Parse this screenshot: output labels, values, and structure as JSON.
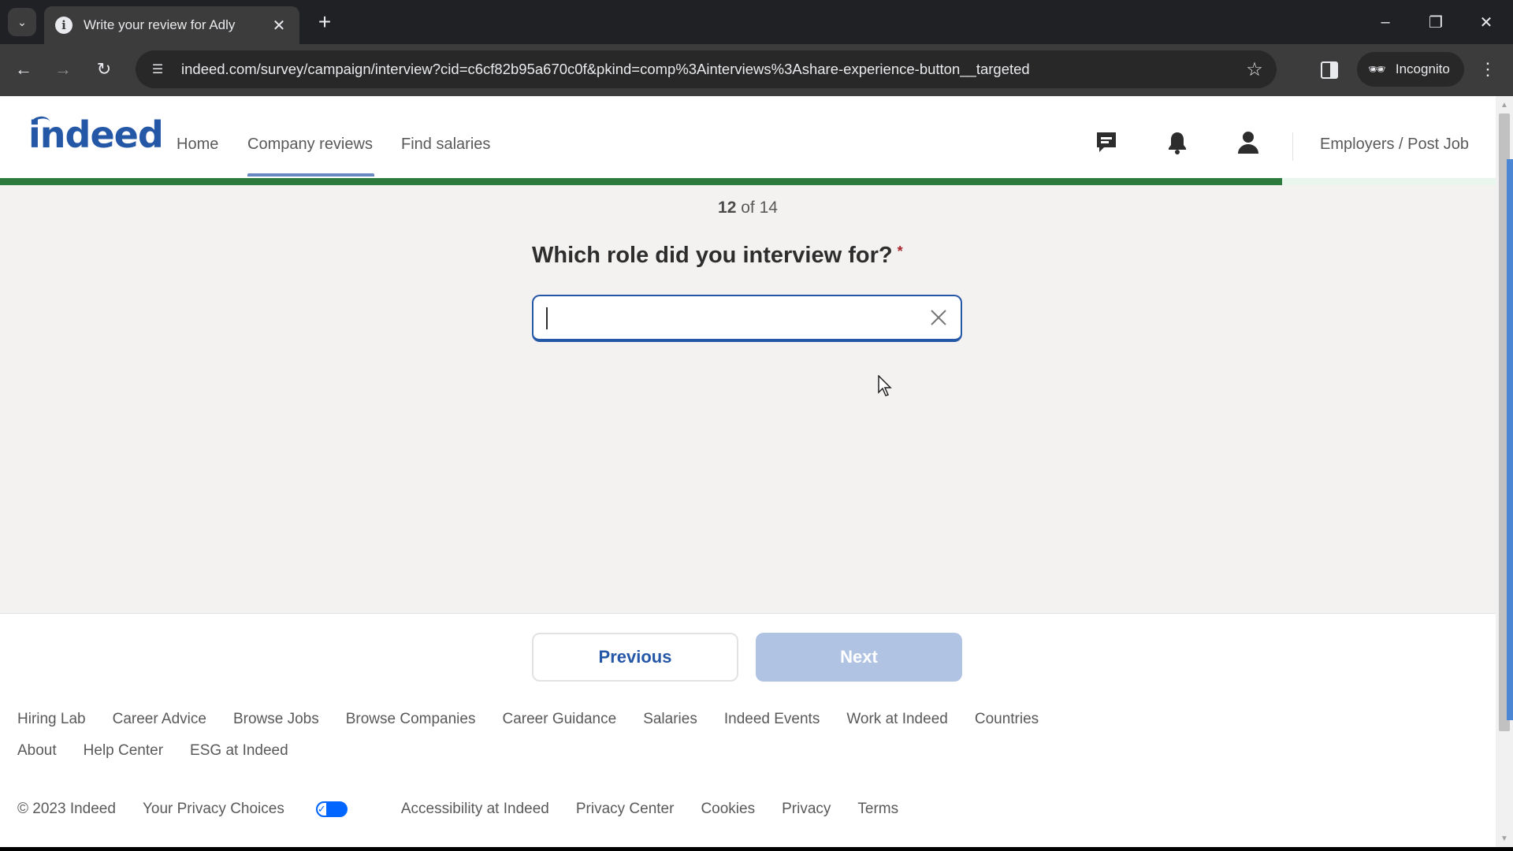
{
  "browser": {
    "tab_title": "Write your review for Adly",
    "url": "indeed.com/survey/campaign/interview?cid=c6cf82b95a670c0f&pkind=comp%3Ainterviews%3Ashare-experience-button__targeted",
    "incognito_label": "Incognito"
  },
  "header": {
    "logo": "indeed",
    "nav": [
      {
        "label": "Home",
        "active": false
      },
      {
        "label": "Company reviews",
        "active": true
      },
      {
        "label": "Find salaries",
        "active": false
      }
    ],
    "icons": [
      "messages-icon",
      "notifications-icon",
      "account-icon"
    ],
    "employers_link": "Employers / Post Job"
  },
  "survey": {
    "progress_fraction": 0.857,
    "step_current": "12",
    "step_total_text": "of 14",
    "question": "Which role did you interview for?",
    "required_marker": "*",
    "role_input": {
      "value": "",
      "placeholder": ""
    },
    "previous_label": "Previous",
    "next_label": "Next",
    "next_disabled": true
  },
  "footer": {
    "links_row1": [
      "Hiring Lab",
      "Career Advice",
      "Browse Jobs",
      "Browse Companies",
      "Career Guidance",
      "Salaries",
      "Indeed Events",
      "Work at Indeed",
      "Countries"
    ],
    "links_row2": [
      "About",
      "Help Center",
      "ESG at Indeed"
    ],
    "copyright": "© 2023 Indeed",
    "privacy_choices": "Your Privacy Choices",
    "links_row3": [
      "Accessibility at Indeed",
      "Privacy Center",
      "Cookies",
      "Privacy",
      "Terms"
    ]
  },
  "colors": {
    "brand_blue": "#2557a7",
    "progress_green": "#2d7a3e",
    "required_red": "#a9252b",
    "next_disabled_bg": "#b1c3e3"
  }
}
